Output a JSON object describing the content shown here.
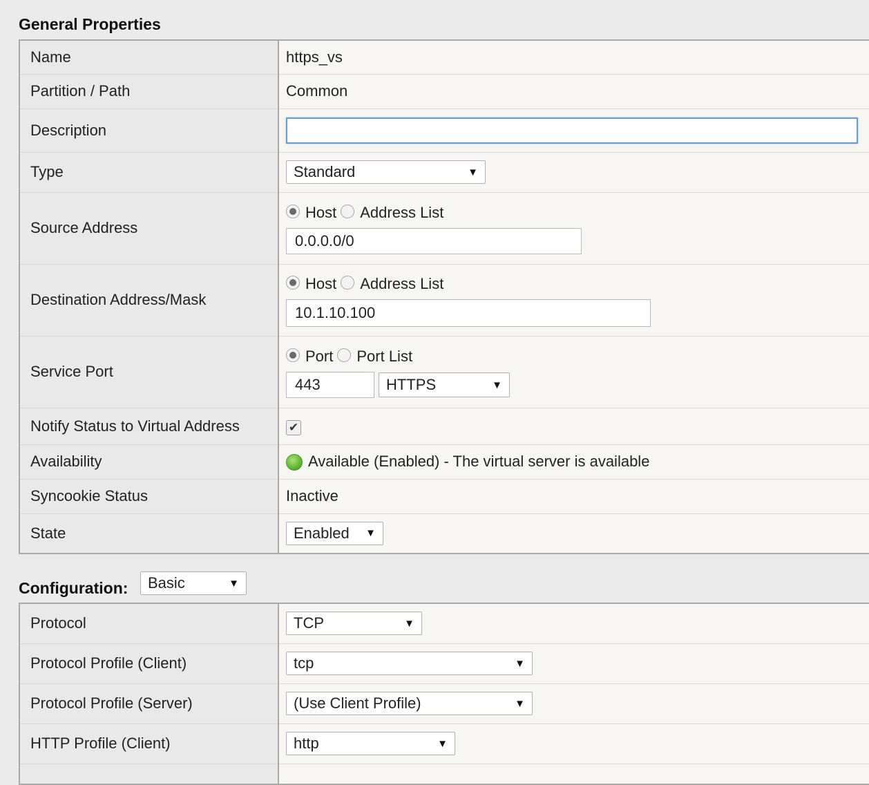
{
  "general": {
    "title": "General Properties",
    "name_label": "Name",
    "name_value": "https_vs",
    "partition_label": "Partition / Path",
    "partition_value": "Common",
    "description_label": "Description",
    "description_value": "",
    "type_label": "Type",
    "type_value": "Standard",
    "source_label": "Source Address",
    "source_opt_host": "Host",
    "source_opt_list": "Address List",
    "source_value": "0.0.0.0/0",
    "dest_label": "Destination Address/Mask",
    "dest_opt_host": "Host",
    "dest_opt_list": "Address List",
    "dest_value": "10.1.10.100",
    "port_label": "Service Port",
    "port_opt_port": "Port",
    "port_opt_list": "Port List",
    "port_value": "443",
    "port_service": "HTTPS",
    "notify_label": "Notify Status to Virtual Address",
    "notify_checked": true,
    "availability_label": "Availability",
    "availability_value": "Available (Enabled) - The virtual server is available",
    "syncookie_label": "Syncookie Status",
    "syncookie_value": "Inactive",
    "state_label": "State",
    "state_value": "Enabled"
  },
  "configuration": {
    "title": "Configuration:",
    "mode": "Basic",
    "protocol_label": "Protocol",
    "protocol_value": "TCP",
    "client_profile_label": "Protocol Profile (Client)",
    "client_profile_value": "tcp",
    "server_profile_label": "Protocol Profile (Server)",
    "server_profile_value": "(Use Client Profile)",
    "http_profile_label": "HTTP Profile (Client)",
    "http_profile_value": "http"
  },
  "colors": {
    "status_available": "#5fb832",
    "focus_border": "#6d9ad9"
  },
  "icons": {
    "dropdown": "caret-down-icon",
    "status": "green-circle-icon",
    "check": "checkmark-icon"
  }
}
